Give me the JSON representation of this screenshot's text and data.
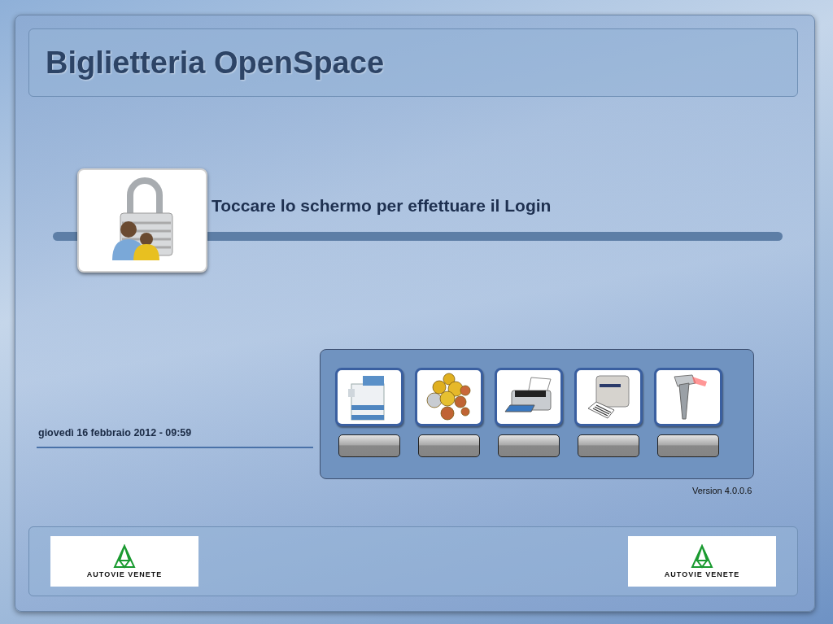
{
  "header": {
    "title": "Biglietteria OpenSpace"
  },
  "login": {
    "message": "Toccare lo schermo per effettuare il Login"
  },
  "date_time": "giovedì 16 febbraio 2012 - 09:59",
  "devices": [
    {
      "kind": "ticket-machine"
    },
    {
      "kind": "coins"
    },
    {
      "kind": "printer"
    },
    {
      "kind": "label-printer"
    },
    {
      "kind": "scanner"
    }
  ],
  "version": "Version 4.0.0.6",
  "footer": {
    "logos": [
      {
        "text": "AUTOVIE VENETE"
      },
      {
        "text": "AUTOVIE VENETE"
      }
    ]
  }
}
